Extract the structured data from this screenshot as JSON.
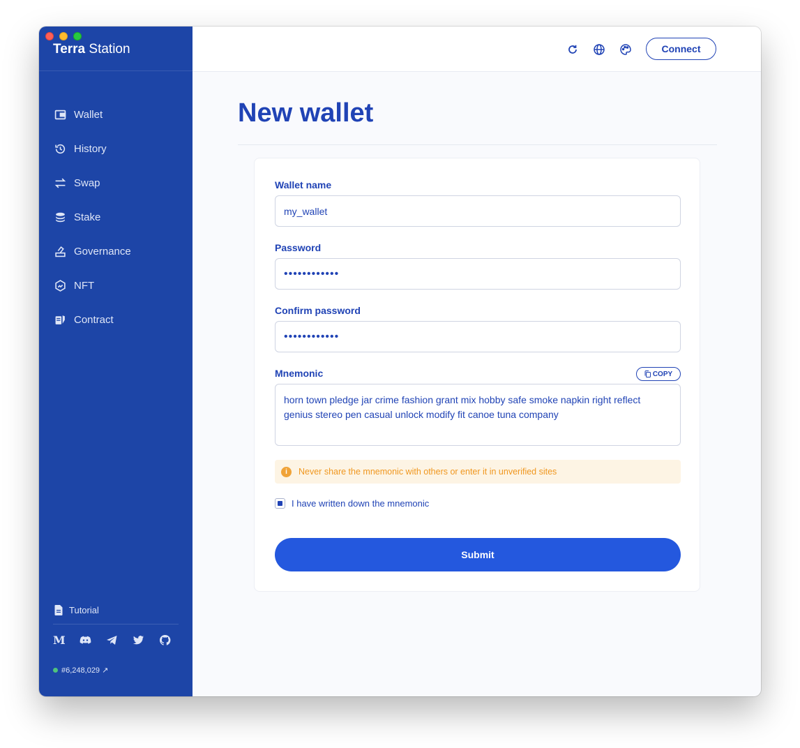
{
  "app": {
    "brand_bold": "Terra",
    "brand_light": " Station"
  },
  "sidebar": {
    "items": [
      {
        "label": "Wallet",
        "icon": "wallet-icon"
      },
      {
        "label": "History",
        "icon": "history-icon"
      },
      {
        "label": "Swap",
        "icon": "swap-icon"
      },
      {
        "label": "Stake",
        "icon": "stake-icon"
      },
      {
        "label": "Governance",
        "icon": "governance-icon"
      },
      {
        "label": "NFT",
        "icon": "nft-icon"
      },
      {
        "label": "Contract",
        "icon": "contract-icon"
      }
    ],
    "tutorial": "Tutorial",
    "socials": [
      "medium-icon",
      "discord-icon",
      "telegram-icon",
      "twitter-icon",
      "github-icon"
    ],
    "block_height": "#6,248,029",
    "block_link_glyph": "↗"
  },
  "header": {
    "icons": [
      "refresh-icon",
      "globe-icon",
      "palette-icon"
    ],
    "connect_label": "Connect"
  },
  "page": {
    "title": "New wallet"
  },
  "form": {
    "wallet_name_label": "Wallet name",
    "wallet_name_value": "my_wallet",
    "password_label": "Password",
    "password_value": "••••••••••••",
    "confirm_label": "Confirm password",
    "confirm_value": "••••••••••••",
    "mnemonic_label": "Mnemonic",
    "copy_label": "COPY",
    "mnemonic_value": "horn town pledge jar crime fashion grant mix hobby safe smoke napkin right reflect genius stereo pen casual unlock modify fit canoe tuna company",
    "warning_icon": "i",
    "warning_text": "Never share the mnemonic with others or enter it in unverified sites",
    "checkbox_label": "I have written down the mnemonic",
    "checkbox_checked": true,
    "submit_label": "Submit"
  },
  "colors": {
    "sidebar_bg": "#1d45a7",
    "accent": "#2043b5",
    "submit_bg": "#2458de",
    "warning_bg": "#fdf4e4",
    "warning_text": "#f0971f",
    "status_dot": "#4fc37c"
  }
}
